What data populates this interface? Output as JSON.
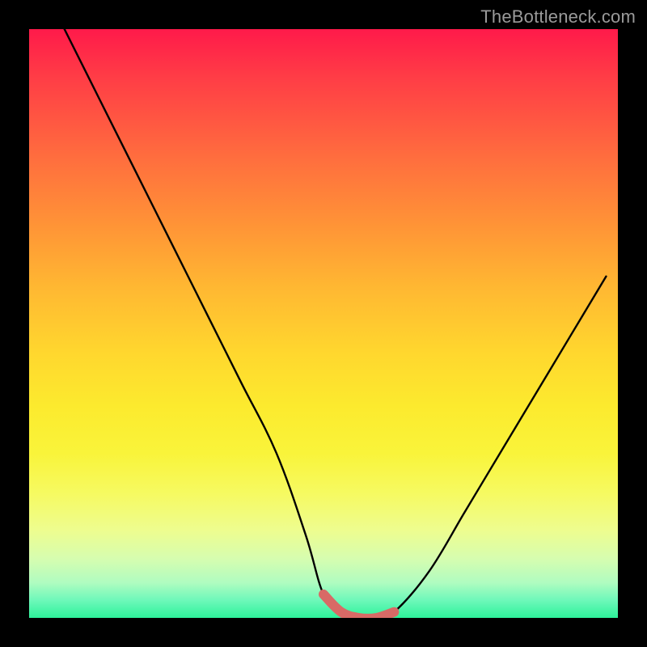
{
  "watermark": "TheBottleneck.com",
  "chart_data": {
    "type": "line",
    "title": "",
    "xlabel": "",
    "ylabel": "",
    "xlim": [
      0,
      100
    ],
    "ylim": [
      0,
      100
    ],
    "grid": false,
    "legend": false,
    "series": [
      {
        "name": "bottleneck-curve",
        "color": "#000000",
        "x": [
          6,
          12,
          18,
          24,
          30,
          36,
          42,
          47,
          50,
          53,
          56,
          59,
          62,
          68,
          74,
          80,
          86,
          92,
          98
        ],
        "y": [
          100,
          88,
          76,
          64,
          52,
          40,
          28,
          14,
          4,
          1,
          0,
          0,
          1,
          8,
          18,
          28,
          38,
          48,
          58
        ]
      },
      {
        "name": "optimal-zone",
        "color": "#d86a66",
        "x": [
          50,
          53,
          56,
          59,
          62
        ],
        "y": [
          4,
          1,
          0,
          0,
          1
        ]
      }
    ],
    "gradient_stops": [
      {
        "pos": 0.0,
        "color": "#ff1a4a"
      },
      {
        "pos": 0.08,
        "color": "#ff3c46"
      },
      {
        "pos": 0.22,
        "color": "#ff6e3e"
      },
      {
        "pos": 0.34,
        "color": "#ff9636"
      },
      {
        "pos": 0.44,
        "color": "#ffb832"
      },
      {
        "pos": 0.55,
        "color": "#ffd72e"
      },
      {
        "pos": 0.64,
        "color": "#fcea2e"
      },
      {
        "pos": 0.72,
        "color": "#f9f43a"
      },
      {
        "pos": 0.79,
        "color": "#f6fa62"
      },
      {
        "pos": 0.85,
        "color": "#eefd8e"
      },
      {
        "pos": 0.9,
        "color": "#d6fdb0"
      },
      {
        "pos": 0.94,
        "color": "#b0fcc0"
      },
      {
        "pos": 0.97,
        "color": "#6ef8ba"
      },
      {
        "pos": 1.0,
        "color": "#2df29a"
      }
    ]
  }
}
